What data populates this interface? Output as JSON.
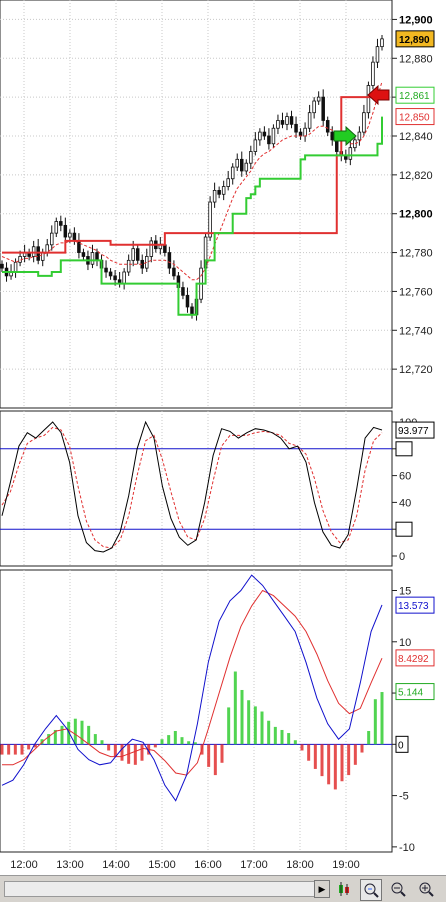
{
  "chart_data": [
    {
      "type": "candlestick",
      "title": "",
      "ylim": [
        12700,
        12910
      ],
      "y_ticks": [
        "12,720",
        "12,740",
        "12,760",
        "12,780",
        "12,800",
        "12,820",
        "12,840",
        "12,860",
        "12,880",
        "12,900"
      ],
      "grid": true,
      "current_price_label": "12,890",
      "green_level_label": "12,861",
      "red_level_label": "12,850",
      "candles_closes": [
        12772,
        12768,
        12770,
        12775,
        12778,
        12780,
        12778,
        12783,
        12776,
        12780,
        12784,
        12790,
        12796,
        12794,
        12788,
        12790,
        12786,
        12780,
        12778,
        12774,
        12780,
        12776,
        12772,
        12770,
        12768,
        12766,
        12764,
        12770,
        12776,
        12782,
        12776,
        12772,
        12778,
        12786,
        12782,
        12784,
        12780,
        12772,
        12768,
        12762,
        12758,
        12752,
        12748,
        12756,
        12772,
        12788,
        12806,
        12812,
        12810,
        12814,
        12818,
        12824,
        12828,
        12822,
        12826,
        12832,
        12838,
        12842,
        12840,
        12836,
        12844,
        12848,
        12846,
        12850,
        12846,
        12842,
        12840,
        12844,
        12852,
        12858,
        12860,
        12848,
        12842,
        12838,
        12832,
        12830,
        12828,
        12834,
        12838,
        12842,
        12852,
        12866,
        12878,
        12886,
        12890
      ],
      "red_trail": [
        12780,
        12780,
        12780,
        12780,
        12780,
        12780,
        12780,
        12780,
        12780,
        12780,
        12780,
        12780,
        12780,
        12780,
        12786,
        12786,
        12786,
        12786,
        12786,
        12786,
        12786,
        12786,
        12786,
        12786,
        12784,
        12784,
        12784,
        12784,
        12784,
        12784,
        12784,
        12784,
        12784,
        12784,
        12784,
        12784,
        12790,
        12790,
        12790,
        12790,
        12790,
        12790,
        12790,
        12790,
        12790,
        12790,
        12790,
        12790,
        12790,
        12790,
        12790,
        12790,
        12790,
        12790,
        12790,
        12790,
        12790,
        12790,
        12790,
        12790,
        12790,
        12790,
        12790,
        12790,
        12790,
        12790,
        12790,
        12790,
        12790,
        12790,
        12790,
        12790,
        12790,
        12790,
        12830,
        12860,
        12860,
        12860,
        12860,
        12860,
        12860,
        12860,
        12860,
        12860,
        12860
      ],
      "green_trail": [
        12770,
        12770,
        12770,
        12770,
        12770,
        12770,
        12770,
        12770,
        12768,
        12768,
        12768,
        12770,
        12770,
        12776,
        12776,
        12776,
        12776,
        12776,
        12776,
        12776,
        12776,
        12776,
        12764,
        12764,
        12764,
        12764,
        12764,
        12764,
        12764,
        12764,
        12764,
        12764,
        12764,
        12764,
        12764,
        12764,
        12764,
        12764,
        12764,
        12748,
        12748,
        12748,
        12748,
        12764,
        12764,
        12776,
        12776,
        12790,
        12790,
        12790,
        12790,
        12800,
        12800,
        12800,
        12808,
        12810,
        12814,
        12818,
        12818,
        12818,
        12818,
        12818,
        12818,
        12818,
        12818,
        12818,
        12828,
        12830,
        12830,
        12830,
        12830,
        12830,
        12830,
        12830,
        12830,
        12830,
        12830,
        12830,
        12830,
        12830,
        12830,
        12830,
        12830,
        12836,
        12850
      ],
      "ma_dashed": [
        12778,
        12777,
        12776,
        12775,
        12776,
        12777,
        12777,
        12778,
        12778,
        12779,
        12780,
        12782,
        12784,
        12785,
        12785,
        12786,
        12786,
        12785,
        12784,
        12783,
        12782,
        12781,
        12779,
        12778,
        12776,
        12775,
        12774,
        12774,
        12774,
        12774,
        12774,
        12774,
        12775,
        12776,
        12776,
        12776,
        12776,
        12775,
        12774,
        12772,
        12770,
        12768,
        12766,
        12766,
        12768,
        12772,
        12778,
        12784,
        12790,
        12796,
        12802,
        12808,
        12813,
        12816,
        12819,
        12822,
        12826,
        12829,
        12831,
        12832,
        12834,
        12836,
        12838,
        12839,
        12840,
        12840,
        12840,
        12840,
        12841,
        12843,
        12845,
        12845,
        12844,
        12843,
        12841,
        12839,
        12837,
        12836,
        12836,
        12837,
        12840,
        12845,
        12852,
        12860,
        12868
      ]
    },
    {
      "type": "line",
      "title": "",
      "ylim": [
        0,
        100
      ],
      "y_ticks": [
        "0",
        "20",
        "40",
        "60",
        "80",
        "100"
      ],
      "reference_lines": [
        20,
        80
      ],
      "current_value_label": "93.977",
      "series": [
        {
          "values": [
            30,
            55,
            82,
            92,
            88,
            94,
            100,
            92,
            70,
            30,
            10,
            4,
            3,
            6,
            18,
            45,
            80,
            100,
            88,
            52,
            28,
            14,
            8,
            12,
            40,
            75,
            95,
            93,
            88,
            92,
            95,
            94,
            92,
            88,
            80,
            82,
            70,
            40,
            18,
            8,
            6,
            16,
            50,
            88,
            96,
            94
          ]
        },
        {
          "values": [
            38,
            48,
            68,
            84,
            88,
            90,
            96,
            94,
            82,
            52,
            26,
            12,
            7,
            6,
            12,
            30,
            60,
            86,
            90,
            72,
            48,
            26,
            14,
            12,
            28,
            56,
            82,
            90,
            90,
            90,
            92,
            93,
            92,
            90,
            84,
            82,
            76,
            58,
            34,
            18,
            10,
            12,
            30,
            64,
            86,
            92
          ]
        }
      ]
    },
    {
      "type": "macd",
      "title": "",
      "ylim": [
        -10.5,
        17
      ],
      "y_ticks": [
        "-10",
        "-5",
        "0",
        "5",
        "10",
        "15"
      ],
      "labels": [
        "13.573",
        "8.4292",
        "5.144",
        "0"
      ],
      "x_ticks": [
        "12:00",
        "13:00",
        "14:00",
        "15:00",
        "16:00",
        "17:00",
        "18:00",
        "19:00"
      ],
      "series": [
        {
          "values": [
            -4,
            -3.5,
            -2,
            0,
            1.5,
            2.8,
            1.5,
            -0.5,
            -1.5,
            -2,
            -1.8,
            -0.5,
            0.5,
            0.2,
            -1.5,
            -4,
            -5.5,
            -3,
            2,
            8,
            12,
            14,
            15,
            16.5,
            15.5,
            14,
            12.5,
            11,
            8,
            4.5,
            2,
            0.5,
            1.5,
            6,
            11,
            13.6
          ]
        },
        {
          "values": [
            -2,
            -2,
            -1.5,
            -0.5,
            0.5,
            1.3,
            1.5,
            0.8,
            0,
            -0.8,
            -1.2,
            -1.2,
            -0.8,
            -0.4,
            -0.6,
            -1.6,
            -2.8,
            -3,
            -1.8,
            1.5,
            5,
            8.5,
            11.5,
            13.5,
            15,
            14.5,
            13.5,
            12.5,
            11,
            8.8,
            6.2,
            4,
            3,
            3.5,
            6,
            8.4
          ]
        },
        {
          "values": [
            -1,
            -1,
            -1,
            -1,
            -0.5,
            -0.3,
            0.5,
            1,
            1.4,
            1.8,
            2.2,
            2.5,
            2.3,
            1.8,
            1,
            0.4,
            -0.6,
            -1.2,
            -1.6,
            -1.9,
            -2,
            -1.6,
            -1,
            -0.3,
            0.5,
            0.9,
            1.3,
            0.7,
            0.3,
            0.2,
            -1,
            -2.2,
            -3,
            -1.8,
            3.6,
            7.1,
            5.3,
            4.3,
            3.7,
            3.2,
            2.3,
            1.7,
            1.4,
            1.1,
            0.4,
            -0.6,
            -1.6,
            -2.4,
            -3.1,
            -3.9,
            -4.4,
            -3.6,
            -3,
            -2,
            -0.8,
            1.3,
            4.4,
            5.1
          ]
        }
      ]
    }
  ],
  "toolbar": {
    "scroll_right_icon": "triangle-right",
    "icons": [
      "candlestick-icon",
      "zoom-fit-icon",
      "zoom-out-icon",
      "zoom-in-icon"
    ]
  },
  "colors": {
    "red": "#e03030",
    "green": "#33cc33",
    "blue": "#1010cc",
    "price_badge_bg": "#f2b822",
    "grid": "#c8c8c8"
  }
}
